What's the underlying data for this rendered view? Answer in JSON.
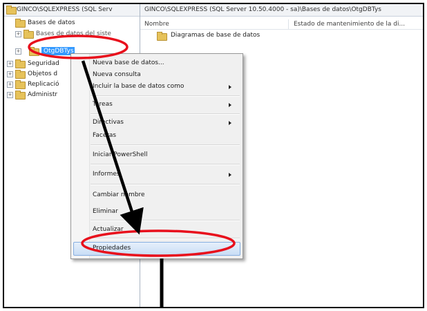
{
  "left_pane": {
    "header": "GINCO\\SQLEXPRESS (SQL Serv",
    "tree": [
      {
        "label": "Bases de datos"
      },
      {
        "label": "Bases de datos del siste"
      },
      {
        "label": "OtgDBTys"
      },
      {
        "label": "Seguridad"
      },
      {
        "label": "Objetos d"
      },
      {
        "label": "Replicació"
      },
      {
        "label": "Administr"
      }
    ]
  },
  "right_pane": {
    "header": "GINCO\\SQLEXPRESS (SQL Server 10.50.4000 - sa)\\Bases de datos\\OtgDBTys",
    "columns": [
      "Nombre",
      "Estado de mantenimiento de la di..."
    ],
    "items": [
      "Diagramas de base de datos"
    ]
  },
  "context_menu": {
    "items": [
      {
        "label": "Nueva base de datos...",
        "submenu": false
      },
      {
        "label": "Nueva consulta",
        "submenu": false
      },
      {
        "label": "Incluir la base de datos como",
        "submenu": true
      },
      {
        "label": "Tareas",
        "submenu": true
      },
      {
        "label": "Directivas",
        "submenu": true
      },
      {
        "label": "Facetas",
        "submenu": false
      },
      {
        "label": "Iniciar PowerShell",
        "submenu": false
      },
      {
        "label": "Informes",
        "submenu": true
      },
      {
        "label": "Cambiar nombre",
        "submenu": false
      },
      {
        "label": "Eliminar",
        "submenu": false
      },
      {
        "label": "Actualizar",
        "submenu": false
      },
      {
        "label": "Propiedades",
        "submenu": false
      }
    ]
  },
  "colors": {
    "annotation_red": "#e8101c",
    "annotation_arrow": "#000000",
    "selection_blue": "#3399ff",
    "folder_yellow": "#e6c25a"
  }
}
